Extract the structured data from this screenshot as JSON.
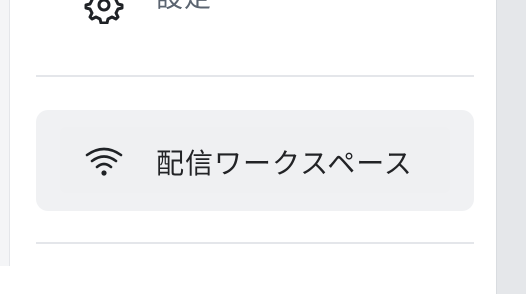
{
  "menu": {
    "settings": {
      "label": "設定",
      "icon": "gear-icon"
    },
    "workspace": {
      "label": "配信ワークスペース",
      "icon": "wifi-icon"
    }
  },
  "colors": {
    "panel_bg": "#ffffff",
    "button_bg": "#f0f1f3",
    "divider": "#e4e6ea",
    "text_primary": "#222326",
    "text_muted": "#5b6470"
  }
}
